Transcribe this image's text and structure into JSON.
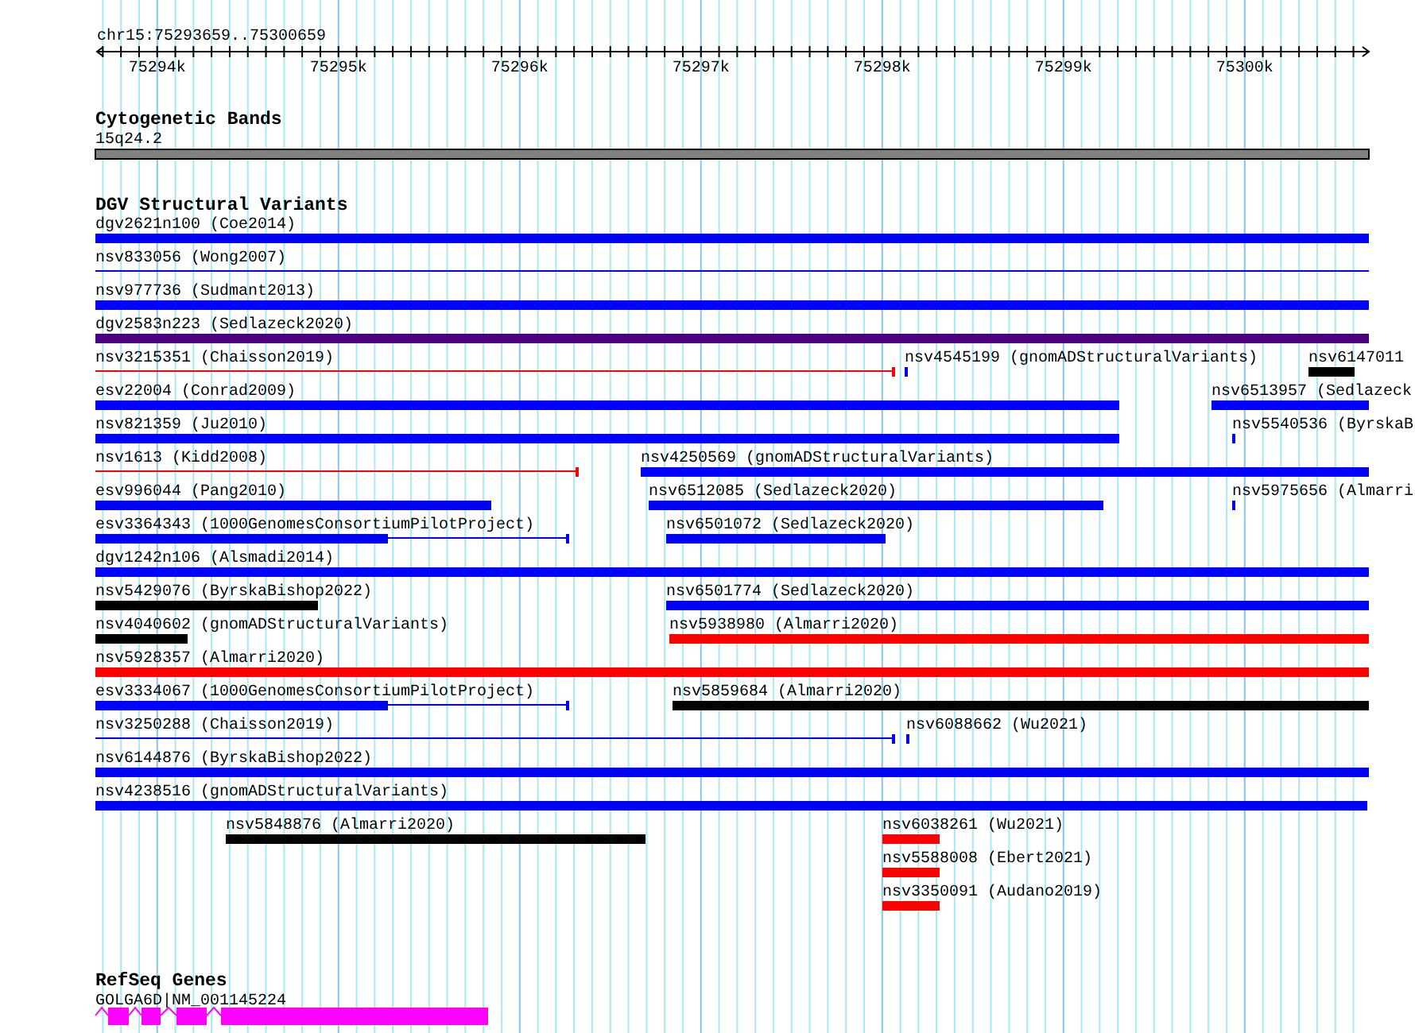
{
  "ruler": {
    "location": "chr15:75293659..75300659",
    "ticks": [
      "75294k",
      "75295k",
      "75296k",
      "75297k",
      "75298k",
      "75299k",
      "75300k"
    ]
  },
  "tracks": [
    {
      "title": "Cytogenetic Bands",
      "kind": "cytoband",
      "band": "15q24.2"
    },
    {
      "title": "DGV Structural Variants",
      "kind": "variants",
      "rows": [
        {
          "features": [
            {
              "label": "dgv2621n100 (Coe2014)",
              "color": "#0000ff",
              "kind": "thick"
            }
          ]
        },
        {
          "features": [
            {
              "label": "nsv833056 (Wong2007)",
              "color": "#0000ff",
              "kind": "line"
            }
          ]
        },
        {
          "features": [
            {
              "label": "nsv977736 (Sudmant2013)",
              "color": "#0000ff",
              "kind": "thick"
            }
          ]
        },
        {
          "features": [
            {
              "label": "dgv2583n223 (Sedlazeck2020)",
              "color": "#4b0082",
              "kind": "thick"
            }
          ]
        },
        {
          "features": [
            {
              "label": "nsv3215351 (Chaisson2019)",
              "color": "#ff0000",
              "kind": "capped"
            },
            {
              "label": "nsv4545199 (gnomADStructuralVariants)",
              "color": "#0000ff",
              "kind": "thick"
            },
            {
              "label": "nsv6147011",
              "color": "#000000",
              "kind": "thick"
            }
          ]
        },
        {
          "features": [
            {
              "label": "esv22004 (Conrad2009)",
              "color": "#0000ff",
              "kind": "thick"
            },
            {
              "label": "nsv6513957 (Sedlazeck",
              "color": "#0000ff",
              "kind": "thick"
            }
          ]
        },
        {
          "features": [
            {
              "label": "nsv821359 (Ju2010)",
              "color": "#0000ff",
              "kind": "thick"
            },
            {
              "label": "nsv5540536 (ByrskaB",
              "color": "#0000ff",
              "kind": "thick"
            }
          ]
        },
        {
          "features": [
            {
              "label": "nsv1613 (Kidd2008)",
              "color": "#ff0000",
              "kind": "capped"
            },
            {
              "label": "nsv4250569 (gnomADStructuralVariants)",
              "color": "#0000ff",
              "kind": "thick"
            }
          ]
        },
        {
          "features": [
            {
              "label": "esv996044 (Pang2010)",
              "color": "#0000ff",
              "kind": "thick"
            },
            {
              "label": "nsv6512085 (Sedlazeck2020)",
              "color": "#0000ff",
              "kind": "thick"
            },
            {
              "label": "nsv5975656 (Almarri",
              "color": "#0000ff",
              "kind": "thick"
            }
          ]
        },
        {
          "features": [
            {
              "label": "esv3364343 (1000GenomesConsortiumPilotProject)",
              "color": "#0000ff",
              "kind": "split"
            },
            {
              "label": "nsv6501072 (Sedlazeck2020)",
              "color": "#0000ff",
              "kind": "thick"
            }
          ]
        },
        {
          "features": [
            {
              "label": "dgv1242n106 (Alsmadi2014)",
              "color": "#0000ff",
              "kind": "thick"
            }
          ]
        },
        {
          "features": [
            {
              "label": "nsv5429076 (ByrskaBishop2022)",
              "color": "#000000",
              "kind": "thick"
            },
            {
              "label": "nsv6501774 (Sedlazeck2020)",
              "color": "#0000ff",
              "kind": "thick"
            }
          ]
        },
        {
          "features": [
            {
              "label": "nsv4040602 (gnomADStructuralVariants)",
              "color": "#000000",
              "kind": "thick"
            },
            {
              "label": "nsv5938980 (Almarri2020)",
              "color": "#ff0000",
              "kind": "thick"
            }
          ]
        },
        {
          "features": [
            {
              "label": "nsv5928357 (Almarri2020)",
              "color": "#ff0000",
              "kind": "thick"
            }
          ]
        },
        {
          "features": [
            {
              "label": "esv3334067 (1000GenomesConsortiumPilotProject)",
              "color": "#0000ff",
              "kind": "split"
            },
            {
              "label": "nsv5859684 (Almarri2020)",
              "color": "#000000",
              "kind": "thick"
            }
          ]
        },
        {
          "features": [
            {
              "label": "nsv3250288 (Chaisson2019)",
              "color": "#0000ff",
              "kind": "capped"
            },
            {
              "label": "nsv6088662 (Wu2021)",
              "color": "#0000ff",
              "kind": "thick"
            }
          ]
        },
        {
          "features": [
            {
              "label": "nsv6144876 (ByrskaBishop2022)",
              "color": "#0000ff",
              "kind": "thick"
            }
          ]
        },
        {
          "features": [
            {
              "label": "nsv4238516 (gnomADStructuralVariants)",
              "color": "#0000ff",
              "kind": "thick"
            }
          ]
        },
        {
          "features": [
            {
              "label": "nsv5848876 (Almarri2020)",
              "color": "#000000",
              "kind": "thick"
            },
            {
              "label": "nsv6038261 (Wu2021)",
              "color": "#ff0000",
              "kind": "thick"
            }
          ]
        },
        {
          "features": [
            {
              "label": "nsv5588008 (Ebert2021)",
              "color": "#ff0000",
              "kind": "thick"
            }
          ]
        },
        {
          "features": [
            {
              "label": "nsv3350091 (Audano2019)",
              "color": "#ff0000",
              "kind": "thick"
            }
          ]
        }
      ]
    },
    {
      "title": "RefSeq Genes",
      "kind": "genes",
      "gene": "GOLGA6D|NM_001145224"
    }
  ]
}
